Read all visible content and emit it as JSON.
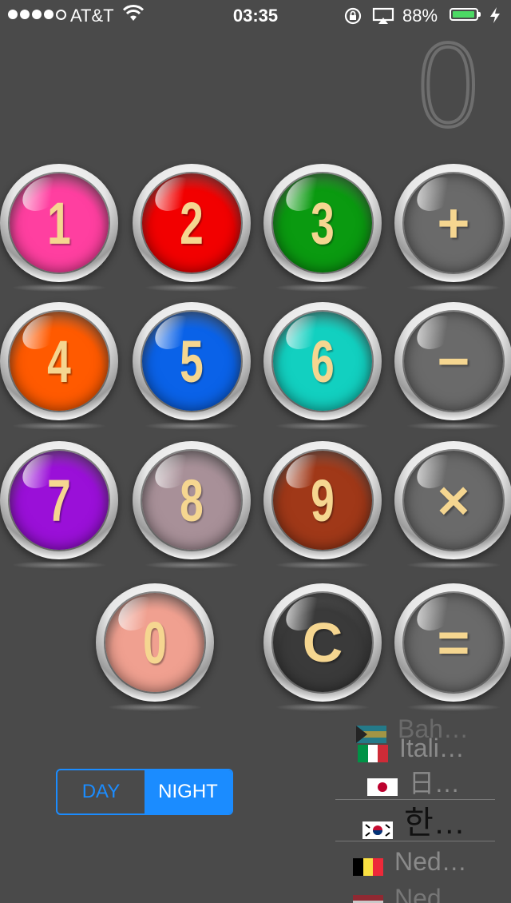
{
  "status_bar": {
    "carrier": "AT&T",
    "time": "03:35",
    "battery_percent": "88%",
    "battery_level": 0.88,
    "signal_bars": 4,
    "icons": [
      "signal-dots-icon",
      "wifi-icon",
      "rotation-lock-icon",
      "airplay-icon",
      "battery-icon",
      "charging-bolt-icon"
    ]
  },
  "display": {
    "value": "0"
  },
  "keys": [
    {
      "label": "1",
      "color": "#ff3fa0",
      "name": "key-1"
    },
    {
      "label": "2",
      "color": "#f20000",
      "name": "key-2"
    },
    {
      "label": "3",
      "color": "#0a9a10",
      "name": "key-3"
    },
    {
      "label": "+",
      "color": "#6a6a6a",
      "name": "key-plus"
    },
    {
      "label": "4",
      "color": "#ff5a00",
      "name": "key-4"
    },
    {
      "label": "5",
      "color": "#0a62e8",
      "name": "key-5"
    },
    {
      "label": "6",
      "color": "#12d0c0",
      "name": "key-6"
    },
    {
      "label": "−",
      "color": "#6a6a6a",
      "name": "key-minus"
    },
    {
      "label": "7",
      "color": "#9a10d8",
      "name": "key-7"
    },
    {
      "label": "8",
      "color": "#a89098",
      "name": "key-8"
    },
    {
      "label": "9",
      "color": "#a03818",
      "name": "key-9"
    },
    {
      "label": "×",
      "color": "#6a6a6a",
      "name": "key-multiply"
    },
    {
      "label": "0",
      "color": "#f0a090",
      "name": "key-0"
    },
    {
      "label": "C",
      "color": "#3a3a3a",
      "name": "key-clear"
    },
    {
      "label": "=",
      "color": "#6a6a6a",
      "name": "key-equals"
    }
  ],
  "mode_toggle": {
    "day": "DAY",
    "night": "NIGHT",
    "selected": "NIGHT"
  },
  "language_picker": {
    "items": [
      {
        "label": "Bah…",
        "flag": "bahamas"
      },
      {
        "label": "Itali…",
        "flag": "italy"
      },
      {
        "label": "日…",
        "flag": "japan"
      },
      {
        "label": "한…",
        "flag": "korea"
      },
      {
        "label": "Ned…",
        "flag": "belgium"
      },
      {
        "label": "Ned…",
        "flag": "netherlands"
      }
    ],
    "selected_index": 3
  }
}
